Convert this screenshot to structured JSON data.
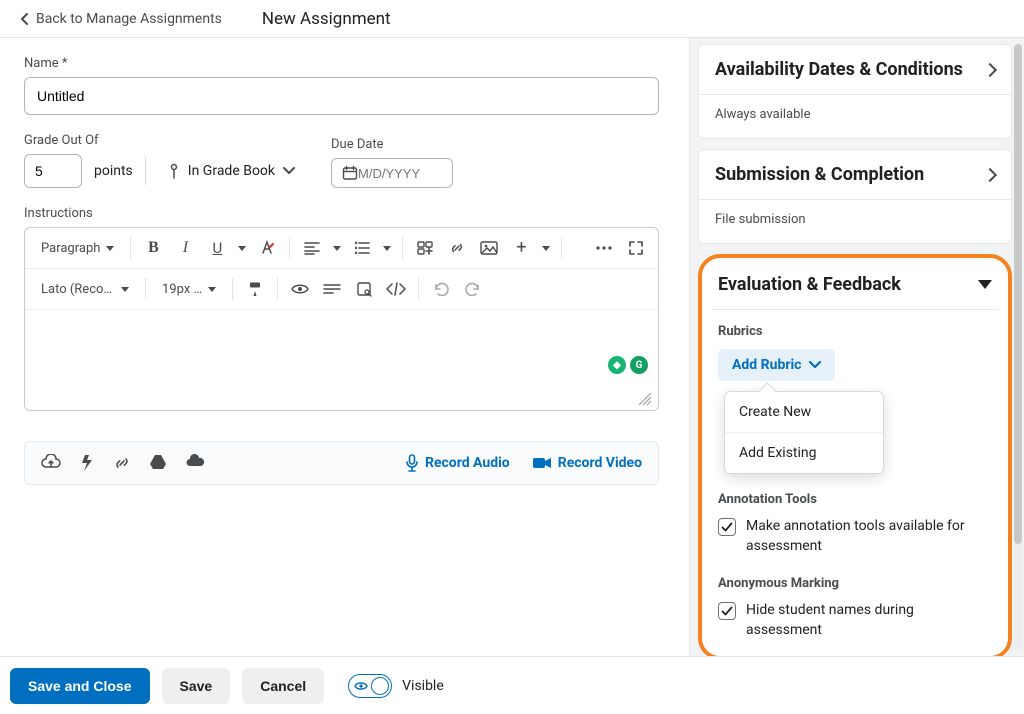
{
  "header": {
    "back_label": "Back to Manage Assignments",
    "title": "New Assignment"
  },
  "form": {
    "name_label": "Name *",
    "name_value": "Untitled",
    "grade_label": "Grade Out Of",
    "grade_value": "5",
    "points_label": "points",
    "grade_book_label": "In Grade Book",
    "due_label": "Due Date",
    "due_placeholder": "M/D/YYYY",
    "instructions_label": "Instructions"
  },
  "editor": {
    "block_style": "Paragraph",
    "font_family": "Lato (Recom…",
    "font_size": "19px …"
  },
  "attach": {
    "record_audio": "Record Audio",
    "record_video": "Record Video"
  },
  "side": {
    "availability": {
      "title": "Availability Dates & Conditions",
      "subtitle": "Always available"
    },
    "submission": {
      "title": "Submission & Completion",
      "subtitle": "File submission"
    },
    "evaluation": {
      "title": "Evaluation & Feedback",
      "rubrics_label": "Rubrics",
      "add_rubric": "Add Rubric",
      "dropdown": {
        "create": "Create New",
        "existing": "Add Existing"
      },
      "annotation_label": "Annotation Tools",
      "annotation_check": "Make annotation tools available for assessment",
      "anon_label": "Anonymous Marking",
      "anon_check": "Hide student names during assessment"
    }
  },
  "footer": {
    "save_close": "Save and Close",
    "save": "Save",
    "cancel": "Cancel",
    "visible": "Visible"
  }
}
